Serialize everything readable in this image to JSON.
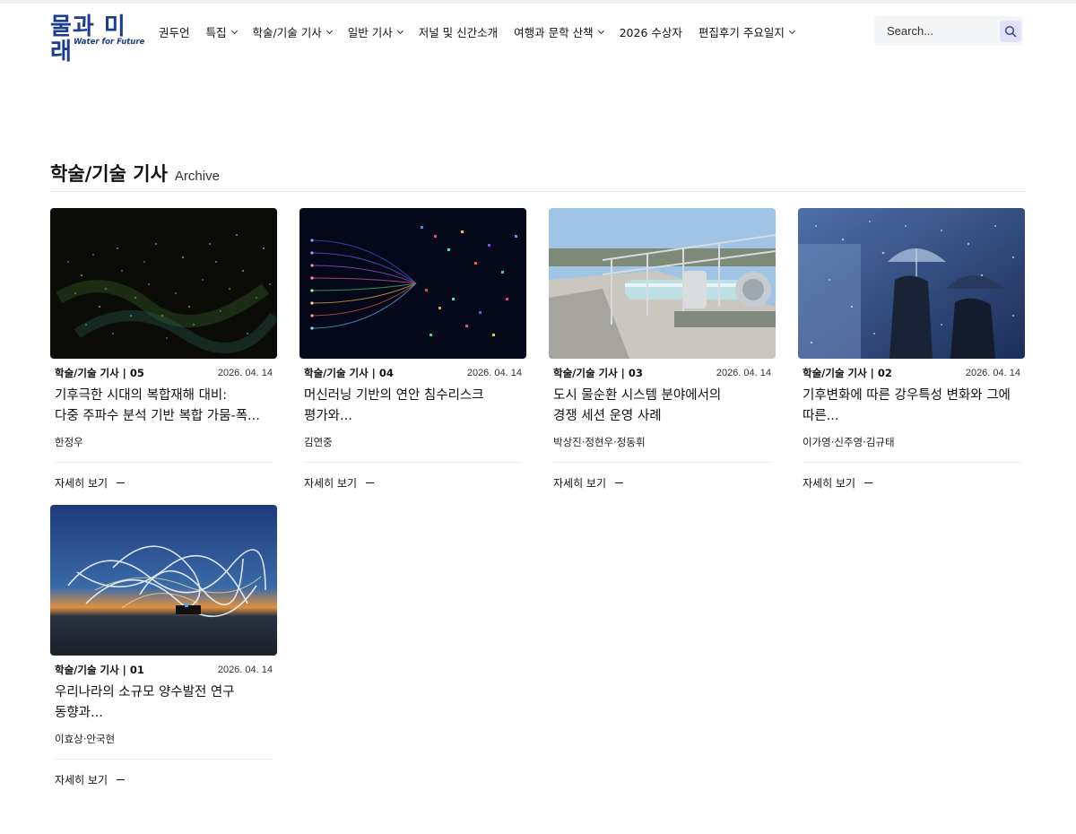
{
  "logo": {
    "korean": "물과 미래",
    "english": "Water for Future"
  },
  "nav": [
    {
      "label": "권두언",
      "has_dropdown": false
    },
    {
      "label": "특집",
      "has_dropdown": true
    },
    {
      "label": "학술/기술 기사",
      "has_dropdown": true
    },
    {
      "label": "일반 기사",
      "has_dropdown": true
    },
    {
      "label": "저널 및 신간소개",
      "has_dropdown": false
    },
    {
      "label": "여행과 문학 산책",
      "has_dropdown": true
    },
    {
      "label": "2026 수상자",
      "has_dropdown": false
    },
    {
      "label": "편집후기 주요일지",
      "has_dropdown": true
    }
  ],
  "search": {
    "placeholder": "Search..."
  },
  "section": {
    "title": "학술/기술 기사",
    "subtitle": "Archive"
  },
  "cards": [
    {
      "category": "학술/기술 기사 | 05",
      "date": "2026. 04. 14",
      "title_line1": "기후극한 시대의 복합재해 대비:",
      "title_line2": "다중 주파수 분석 기반 복합 가뭄-폭...",
      "author": "한정우",
      "more": "자세히 보기"
    },
    {
      "category": "학술/기술 기사 | 04",
      "date": "2026. 04. 14",
      "title_line1": "머신러닝 기반의 연안 침수리스크",
      "title_line2": "평가와...",
      "author": "김연중",
      "more": "자세히 보기"
    },
    {
      "category": "학술/기술 기사 | 03",
      "date": "2026. 04. 14",
      "title_line1": "도시 물순환 시스템 분야에서의",
      "title_line2": "경쟁 세션 운영 사례",
      "author": "박상진·정현우·정동휘",
      "more": "자세히 보기"
    },
    {
      "category": "학술/기술 기사 | 02",
      "date": "2026. 04. 14",
      "title_line1": "기후변화에 따른 강우특성 변화와 그에",
      "title_line2": "따른...",
      "author": "이가영·신주영·김규태",
      "more": "자세히 보기"
    },
    {
      "category": "학술/기술 기사 | 01",
      "date": "2026. 04. 14",
      "title_line1": "우리나라의 소규모 양수발전 연구",
      "title_line2": "동향과...",
      "author": "이효상·안국현",
      "more": "자세히 보기"
    }
  ],
  "colors": {
    "brand": "#1c3d8f",
    "search_bg": "#f4f5f7",
    "search_btn": "#dfe1f6"
  }
}
